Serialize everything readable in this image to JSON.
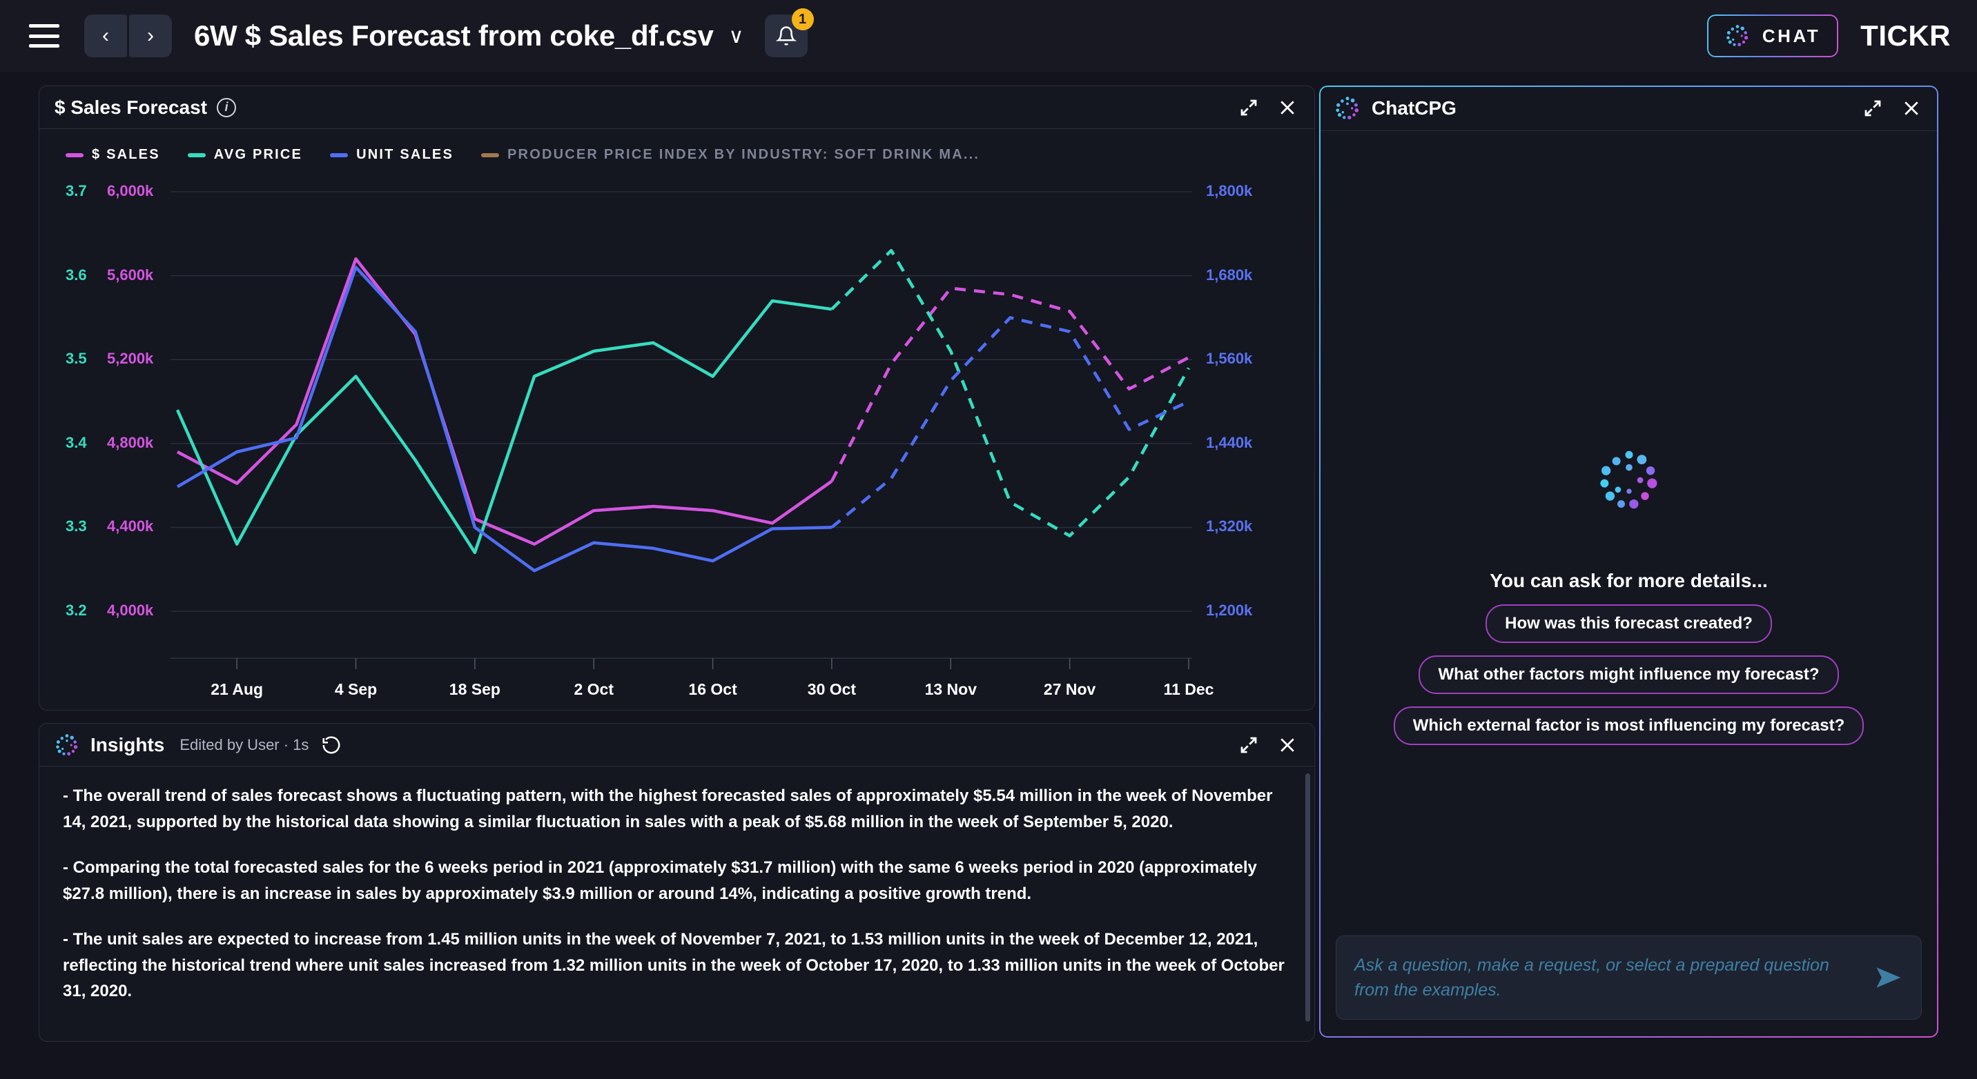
{
  "topbar": {
    "menu_icon": "hamburger-icon",
    "back_label": "‹",
    "forward_label": "›",
    "title": "6W $ Sales Forecast from coke_df.csv",
    "title_caret": "∨",
    "bell_icon": "bell-icon",
    "bell_badge": "1",
    "chat_button_label": "CHAT",
    "brand": "TICKR"
  },
  "chart_panel": {
    "title": "$ Sales Forecast",
    "info_icon": "info-icon",
    "expand_icon": "expand-icon",
    "close_icon": "close-icon"
  },
  "insights_panel": {
    "title": "Insights",
    "meta": "Edited by User · 1s",
    "history_icon": "revert-history-icon",
    "expand_icon": "expand-icon",
    "close_icon": "close-icon",
    "paragraphs": [
      "- The overall trend of sales forecast shows a fluctuating pattern, with the highest forecasted sales of approximately $5.54 million in the week of November 14, 2021, supported by the historical data showing a similar fluctuation in sales with a peak of $5.68 million in the week of September 5, 2020.",
      "- Comparing the total forecasted sales for the 6 weeks period in 2021 (approximately $31.7 million) with the same 6 weeks period in 2020 (approximately $27.8 million), there is an increase in sales by approximately $3.9 million or around 14%, indicating a positive growth trend.",
      "- The unit sales are expected to increase from 1.45 million units in the week of November 7, 2021, to 1.53 million units in the week of December 12, 2021, reflecting the historical trend where unit sales increased from 1.32 million units in the week of October 17, 2020, to 1.33 million units in the week of October 31, 2020."
    ]
  },
  "chat_panel": {
    "title": "ChatCPG",
    "logo_icon": "chatcpg-logo-icon",
    "expand_icon": "expand-icon",
    "close_icon": "close-icon",
    "empty_state_text": "You can ask for more details...",
    "suggestions": [
      "How was this forecast created?",
      "What other factors might influence my forecast?",
      "Which external factor is most influencing my forecast?"
    ],
    "input_placeholder": "Ask a question, make a request, or select a prepared question from the examples.",
    "send_icon": "send-icon"
  },
  "colors": {
    "sales": "#d455e0",
    "avg_price": "#35ddc0",
    "unit_sales": "#4f6ef2",
    "ppi": "#a07a4a",
    "accent_badge": "#f5b31b",
    "panel_bg": "#141620",
    "page_bg": "#12131c"
  },
  "chart_data": {
    "type": "line",
    "title": "$ Sales Forecast",
    "xlabel": "",
    "grid": true,
    "legend_position": "top-left",
    "x_tick_labels": [
      "21 Aug",
      "4 Sep",
      "18 Sep",
      "2 Oct",
      "16 Oct",
      "30 Oct",
      "13 Nov",
      "27 Nov",
      "11 Dec"
    ],
    "axes": [
      {
        "name": "avg_price_axis",
        "side": "left",
        "color": "#35ddc0",
        "ticks": [
          "3.7",
          "3.6",
          "3.5",
          "3.4",
          "3.3",
          "3.2"
        ],
        "range": [
          3.2,
          3.7
        ]
      },
      {
        "name": "sales_axis",
        "side": "left",
        "color": "#d455e0",
        "ticks": [
          "6,000k",
          "5,600k",
          "5,200k",
          "4,800k",
          "4,400k",
          "4,000k"
        ],
        "range": [
          4000,
          6000
        ]
      },
      {
        "name": "unit_sales_axis",
        "side": "right",
        "color": "#5a72f0",
        "ticks": [
          "1,800k",
          "1,680k",
          "1,560k",
          "1,440k",
          "1,320k",
          "1,200k"
        ],
        "range": [
          1200,
          1800
        ]
      }
    ],
    "x": [
      "14 Aug",
      "21 Aug",
      "28 Aug",
      "4 Sep",
      "11 Sep",
      "18 Sep",
      "25 Sep",
      "2 Oct",
      "9 Oct",
      "16 Oct",
      "23 Oct",
      "30 Oct",
      "6 Nov",
      "13 Nov",
      "20 Nov",
      "27 Nov",
      "4 Dec",
      "11 Dec"
    ],
    "forecast_starts_at_index": 11,
    "series": [
      {
        "name": "$ SALES",
        "color": "#d455e0",
        "axis": "sales_axis",
        "unit": "k",
        "values": [
          4760,
          4610,
          4890,
          5680,
          5320,
          4440,
          4320,
          4480,
          4500,
          4480,
          4420,
          4620,
          5180,
          5540,
          5510,
          5430,
          5060,
          5210
        ],
        "dashed_from_index": 11
      },
      {
        "name": "AVG PRICE",
        "color": "#35ddc0",
        "axis": "avg_price_axis",
        "values": [
          3.44,
          3.28,
          3.41,
          3.48,
          3.38,
          3.27,
          3.48,
          3.51,
          3.52,
          3.48,
          3.57,
          3.56,
          3.63,
          3.51,
          3.33,
          3.29,
          3.36,
          3.49
        ],
        "dashed_from_index": 11
      },
      {
        "name": "UNIT SALES",
        "color": "#4f6ef2",
        "axis": "unit_sales_axis",
        "unit": "k",
        "values": [
          1378,
          1428,
          1448,
          1692,
          1600,
          1320,
          1258,
          1298,
          1290,
          1272,
          1318,
          1320,
          1390,
          1530,
          1620,
          1600,
          1460,
          1500
        ],
        "dashed_from_index": 11
      },
      {
        "name": "PRODUCER PRICE INDEX BY INDUSTRY: SOFT DRINK MA...",
        "color": "#a07a4a",
        "axis": "none",
        "values": [],
        "hidden": true
      }
    ]
  }
}
